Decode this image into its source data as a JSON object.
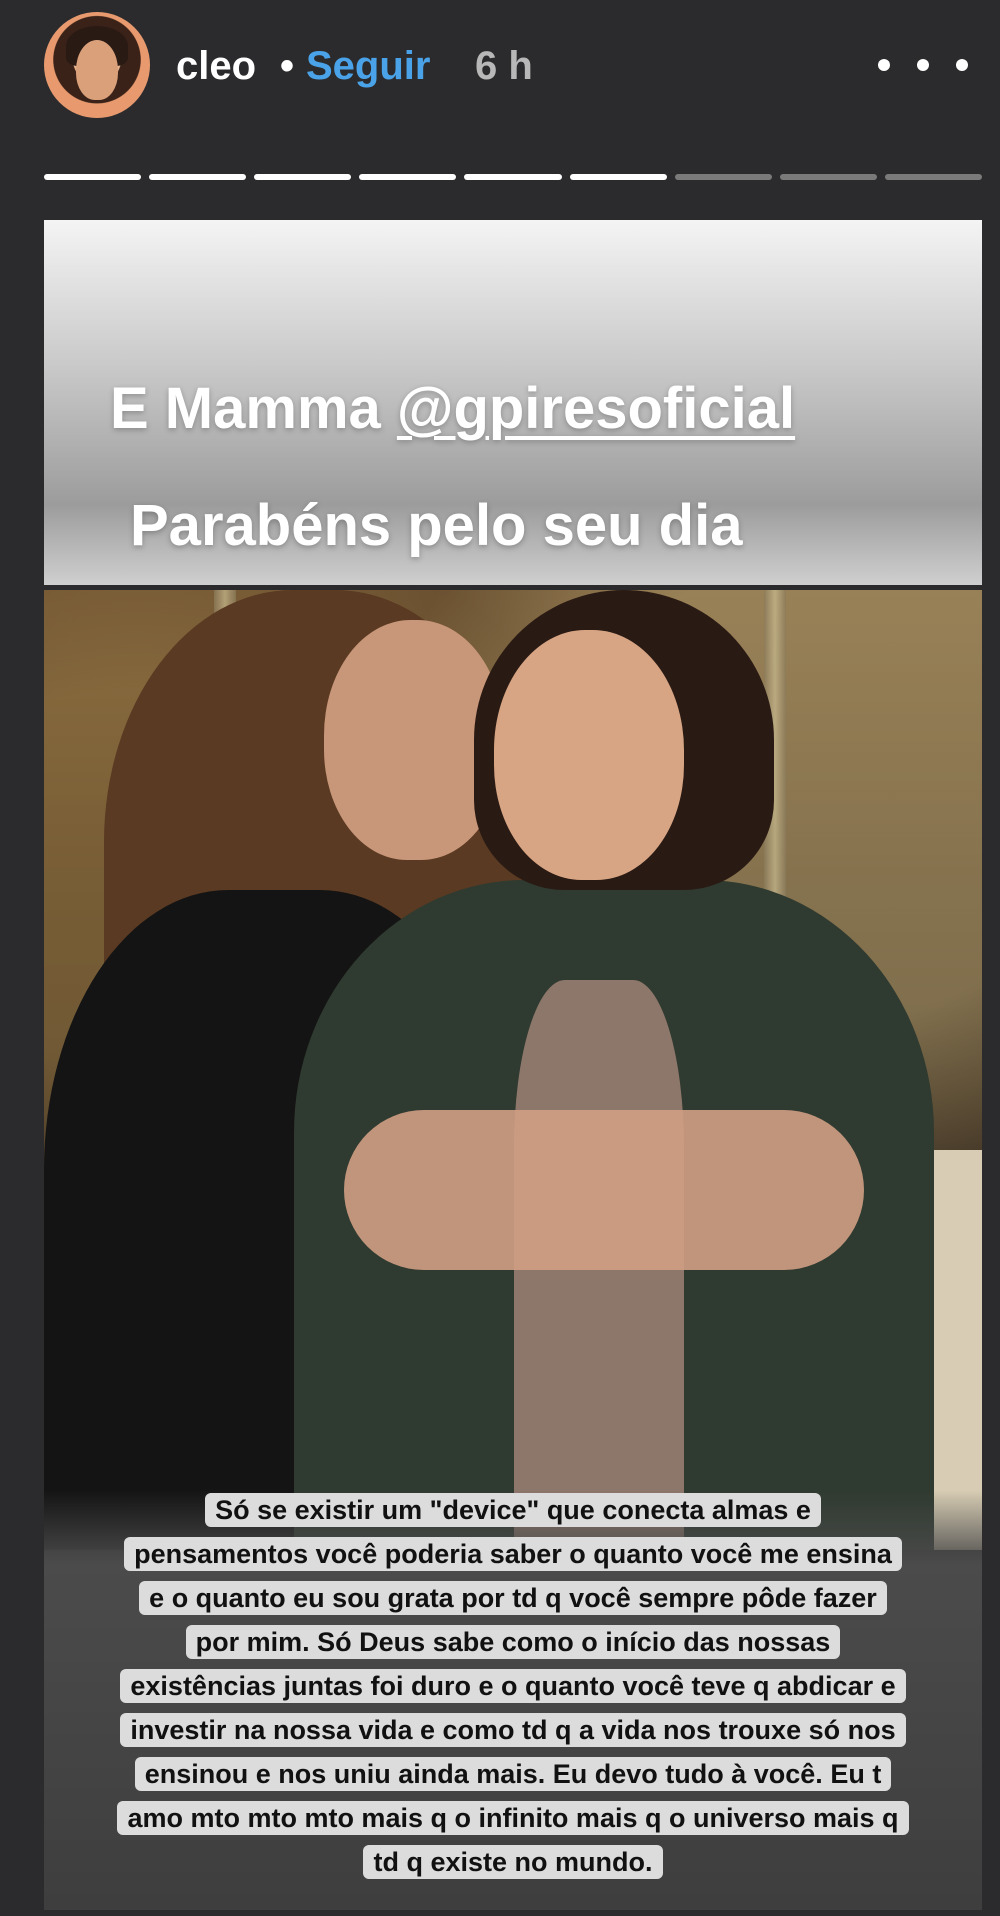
{
  "header": {
    "username": "cleo",
    "separator": "•",
    "follow_label": "Seguir",
    "time_ago": "6 h"
  },
  "progress": {
    "segments_total": 9,
    "segments_viewed": 6
  },
  "story": {
    "banner_line1_prefix": "E Mamma ",
    "banner_mention": "@gpiresoficial",
    "banner_line2": "Parabéns pelo seu dia",
    "caption_lines": [
      "Só se existir um \"device\" que conecta almas e",
      "pensamentos você poderia saber o quanto você me ensina",
      "e o quanto eu sou grata por td q você sempre pôde fazer",
      "por mim. Só Deus sabe como o início das nossas",
      "existências juntas foi duro e o quanto você teve q abdicar e",
      "investir na nossa vida e como td q a vida nos trouxe só nos",
      "ensinou e nos uniu ainda mais. Eu devo tudo à você. Eu t",
      "amo mto mto mto mais q o infinito mais q o universo mais q",
      "td q existe no mundo."
    ]
  },
  "colors": {
    "background": "#2b2b2d",
    "follow": "#4aa3e8",
    "progress_viewed": "#ffffff",
    "progress_remaining": "#7a7a7a"
  },
  "icons": {
    "more": "more-options-icon"
  }
}
